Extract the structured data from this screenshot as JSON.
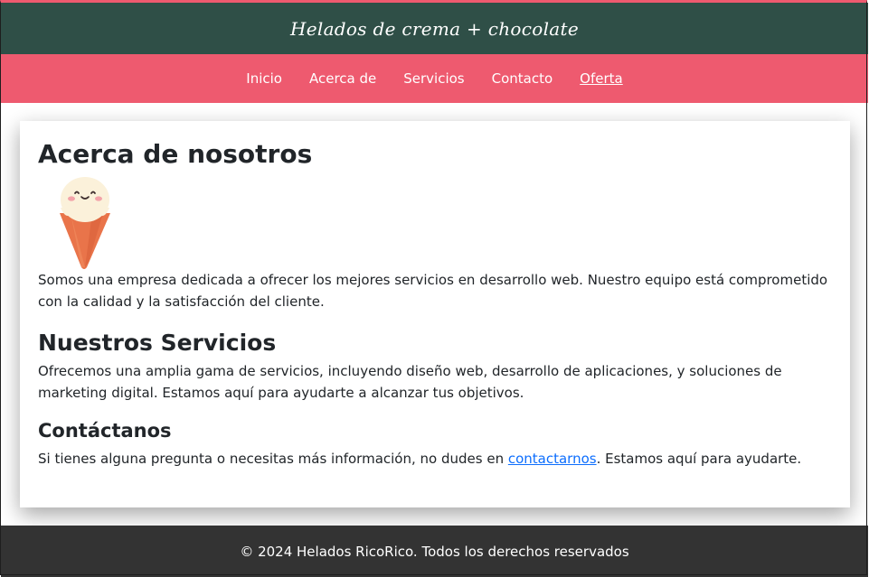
{
  "header": {
    "title": "Helados de crema + chocolate"
  },
  "nav": {
    "items": [
      {
        "label": "Inicio"
      },
      {
        "label": "Acerca de"
      },
      {
        "label": "Servicios"
      },
      {
        "label": "Contacto"
      },
      {
        "label": "Oferta",
        "active": true
      }
    ]
  },
  "about": {
    "heading": "Acerca de nosotros",
    "text": "Somos una empresa dedicada a ofrecer los mejores servicios en desarrollo web. Nuestro equipo está comprometido con la calidad y la satisfacción del cliente.",
    "image_icon": "ice-cream-icon"
  },
  "services": {
    "heading": "Nuestros Servicios",
    "text": "Ofrecemos una amplia gama de servicios, incluyendo diseño web, desarrollo de aplicaciones, y soluciones de marketing digital. Estamos aquí para ayudarte a alcanzar tus objetivos."
  },
  "contact": {
    "heading": "Contáctanos",
    "text_before": "Si tienes alguna pregunta o necesitas más información, no dudes en ",
    "link_text": "contactarnos",
    "text_after": ". Estamos aquí para ayudarte."
  },
  "footer": {
    "text": "© 2024 Helados RicoRico. Todos los derechos reservados"
  },
  "colors": {
    "header_bg": "#2f4f47",
    "nav_bg": "#ee5a6f",
    "footer_bg": "#333333",
    "link": "#0d6efd"
  }
}
